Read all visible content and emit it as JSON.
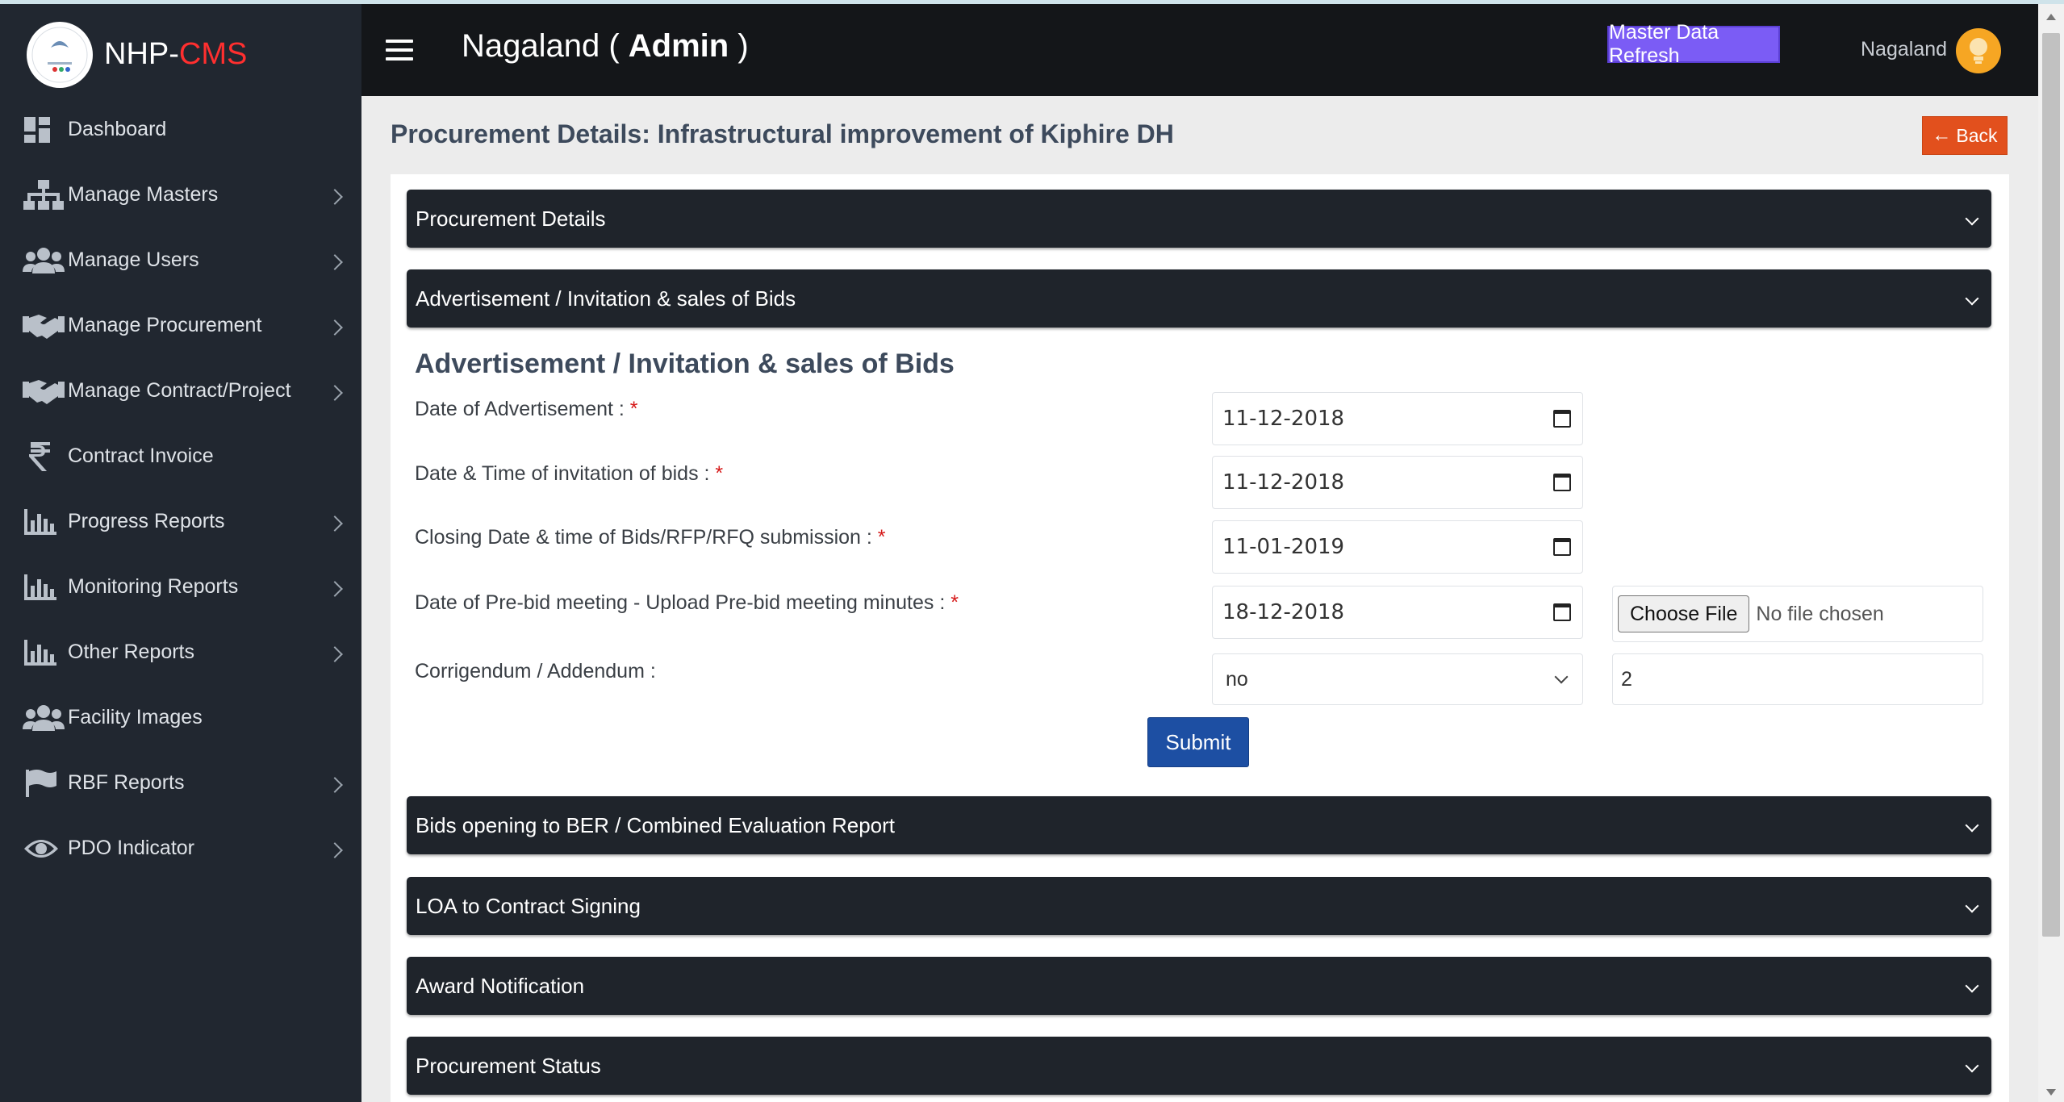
{
  "brand": {
    "name_prefix": "NHP-",
    "name_accent": "CMS"
  },
  "header": {
    "title_prefix": "Nagaland ( ",
    "title_bold": "Admin",
    "title_suffix": " )",
    "refresh_label": "Master Data Refresh",
    "user_name": "Nagaland"
  },
  "sidebar": {
    "items": [
      {
        "label": "Dashboard",
        "icon": "dashboard-icon",
        "has_children": false
      },
      {
        "label": "Manage Masters",
        "icon": "sitemap-icon",
        "has_children": true
      },
      {
        "label": "Manage Users",
        "icon": "users-icon",
        "has_children": true
      },
      {
        "label": "Manage Procurement",
        "icon": "handshake-icon",
        "has_children": true
      },
      {
        "label": "Manage Contract/Project",
        "icon": "handshake-icon",
        "has_children": true
      },
      {
        "label": "Contract Invoice",
        "icon": "rupee-icon",
        "has_children": false
      },
      {
        "label": "Progress Reports",
        "icon": "bar-chart-icon",
        "has_children": true
      },
      {
        "label": "Monitoring Reports",
        "icon": "bar-chart-icon",
        "has_children": true
      },
      {
        "label": "Other Reports",
        "icon": "bar-chart-icon",
        "has_children": true
      },
      {
        "label": "Facility Images",
        "icon": "users-icon",
        "has_children": false
      },
      {
        "label": "RBF Reports",
        "icon": "flag-icon",
        "has_children": true
      },
      {
        "label": "PDO Indicator",
        "icon": "eye-icon",
        "has_children": true
      }
    ]
  },
  "page": {
    "title": "Procurement Details: Infrastructural improvement of Kiphire DH",
    "back_label": "Back"
  },
  "accordions": {
    "procurement_details": "Procurement Details",
    "advertisement": "Advertisement / Invitation & sales of Bids",
    "bids_opening": "Bids opening to BER / Combined Evaluation Report",
    "loa": "LOA to Contract Signing",
    "award": "Award Notification",
    "status": "Procurement Status"
  },
  "form": {
    "section_title": "Advertisement / Invitation & sales of Bids",
    "required_mark": "*",
    "fields": {
      "date_advertisement": {
        "label": "Date of Advertisement : ",
        "value": "11-12-2018"
      },
      "date_invitation": {
        "label": "Date & Time of invitation of bids : ",
        "value": "11-12-2018"
      },
      "closing_date": {
        "label": "Closing Date & time of Bids/RFP/RFQ submission : ",
        "value": "11-01-2019"
      },
      "prebid_date": {
        "label": "Date of Pre-bid meeting - Upload Pre-bid meeting minutes : ",
        "value": "18-12-2018"
      },
      "corrigendum": {
        "label": "Corrigendum / Addendum :",
        "selected": "no",
        "count": "2"
      }
    },
    "file": {
      "button_label": "Choose File",
      "status": "No file chosen"
    },
    "submit_label": "Submit"
  },
  "colors": {
    "sidebar_bg": "#212730",
    "header_bg": "#141619",
    "accent_red": "#ff2f2f",
    "refresh_bg": "#7b5cf5",
    "back_bg": "#e2501d",
    "submit_bg": "#1d4fa3",
    "accordion_bg": "#1f242b"
  }
}
